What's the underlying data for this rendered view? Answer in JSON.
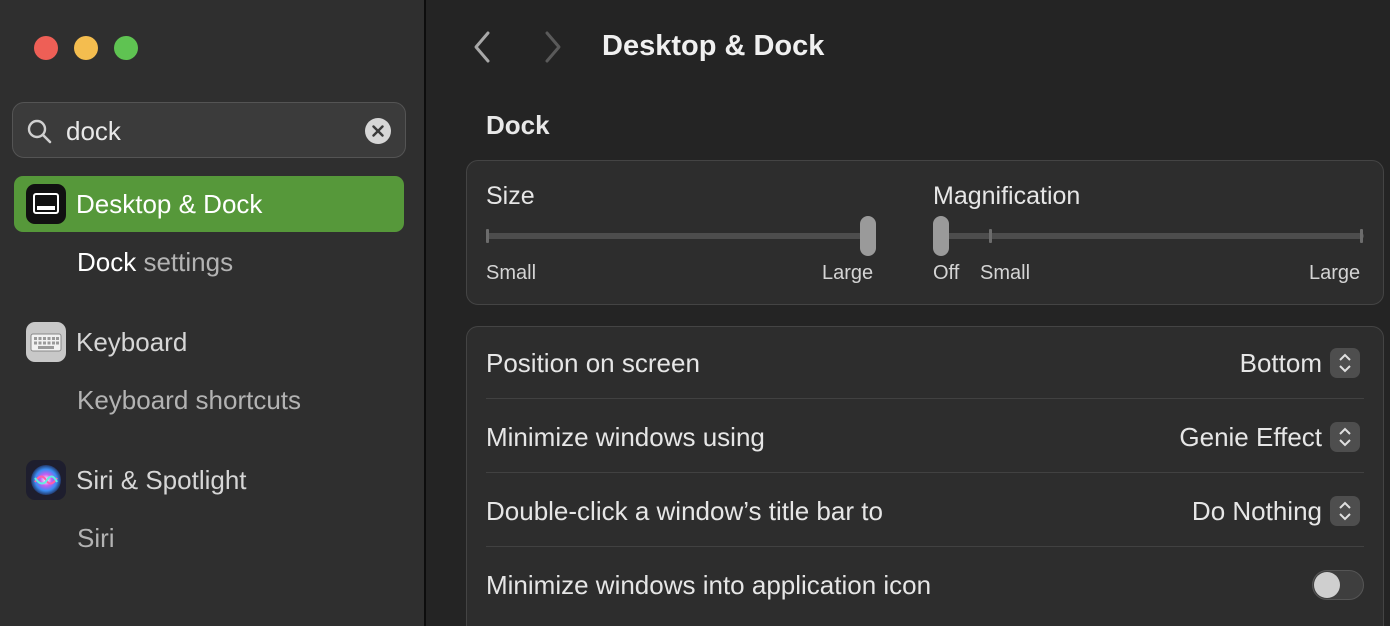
{
  "window": {
    "title": "Desktop & Dock"
  },
  "search": {
    "value": "dock",
    "placeholder": "Search"
  },
  "sidebar": {
    "items": [
      {
        "label": "Desktop & Dock",
        "icon": "desktop-dock-icon",
        "selected": true,
        "sub": {
          "highlight": "Dock",
          "rest": " settings"
        }
      },
      {
        "label": "Keyboard",
        "icon": "keyboard-icon",
        "selected": false,
        "sub": {
          "text": "Keyboard shortcuts"
        }
      },
      {
        "label": "Siri & Spotlight",
        "icon": "siri-icon",
        "selected": false,
        "sub": {
          "text": "Siri"
        }
      }
    ]
  },
  "main": {
    "section": "Dock",
    "size": {
      "title": "Size",
      "min": "Small",
      "max": "Large",
      "level": 1.0
    },
    "magnification": {
      "title": "Magnification",
      "off": "Off",
      "min": "Small",
      "max": "Large",
      "level": 0.0
    },
    "rows": [
      {
        "label": "Position on screen",
        "value": "Bottom"
      },
      {
        "label": "Minimize windows using",
        "value": "Genie Effect"
      },
      {
        "label": "Double-click a window’s title bar to",
        "value": "Do Nothing"
      },
      {
        "label": "Minimize windows into application icon",
        "toggle": false
      }
    ]
  },
  "colors": {
    "selection": "#56983a",
    "background": "#242424",
    "sidebar": "#2f2f2f"
  }
}
